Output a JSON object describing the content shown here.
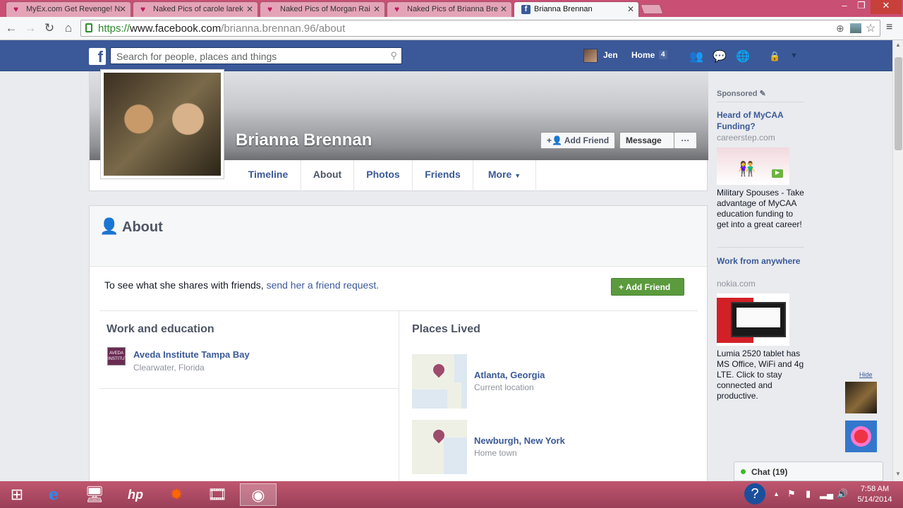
{
  "browser": {
    "tabs": [
      {
        "title": "MyEx.com Get Revenge! N",
        "icon": "heart-icon"
      },
      {
        "title": "Naked Pics of carole larek",
        "icon": "heart-icon"
      },
      {
        "title": "Naked Pics of Morgan Rai",
        "icon": "heart-icon"
      },
      {
        "title": "Naked Pics of Brianna Bre",
        "icon": "heart-icon"
      },
      {
        "title": "Brianna Brennan",
        "icon": "facebook-icon"
      }
    ],
    "url_proto": "https://",
    "url_host": "www.facebook.com",
    "url_path": "/brianna.brennan.96/about",
    "close_glyph": "✕"
  },
  "fb": {
    "logo": "f",
    "search_placeholder": "Search for people, places and things",
    "user_name": "Jen",
    "home_label": "Home",
    "home_count": "4"
  },
  "profile": {
    "name": "Brianna Brennan",
    "add_friend_label": "Add Friend",
    "message_label": "Message",
    "more_dots": "···",
    "tabs": [
      "Timeline",
      "About",
      "Photos",
      "Friends",
      "More"
    ],
    "selected_tab": "About"
  },
  "about": {
    "title": "About",
    "share_text": "To see what she shares with friends, ",
    "share_link": "send her a friend request.",
    "add_friend_label": "Add Friend",
    "work_title": "Work and education",
    "edu_icon_text": "AVEDA INSTITUTE",
    "edu_name": "Aveda Institute Tampa Bay",
    "edu_location": "Clearwater, Florida",
    "places_title": "Places Lived",
    "places": [
      {
        "name": "Atlanta, Georgia",
        "type": "Current location"
      },
      {
        "name": "Newburgh, New York",
        "type": "Home town"
      }
    ]
  },
  "sidebar": {
    "sponsored_label": "Sponsored",
    "ads": [
      {
        "title": "Heard of MyCAA Funding?",
        "domain": "careerstep.com",
        "body": "Military Spouses - Take advantage of MyCAA education funding to get into a great career!"
      },
      {
        "title": "Work from anywhere",
        "domain": "nokia.com",
        "body": "Lumia 2520 tablet has MS Office, WiFi and 4g LTE. Click to stay connected and productive."
      }
    ],
    "hide_label": "Hide",
    "chat_label": "Chat (19)"
  },
  "taskbar": {
    "time": "7:58 AM",
    "date": "5/14/2014"
  },
  "colors": {
    "facebook_blue": "#3b5998",
    "taskbar": "#c0566f",
    "add_friend_green": "#5b9a3d"
  }
}
